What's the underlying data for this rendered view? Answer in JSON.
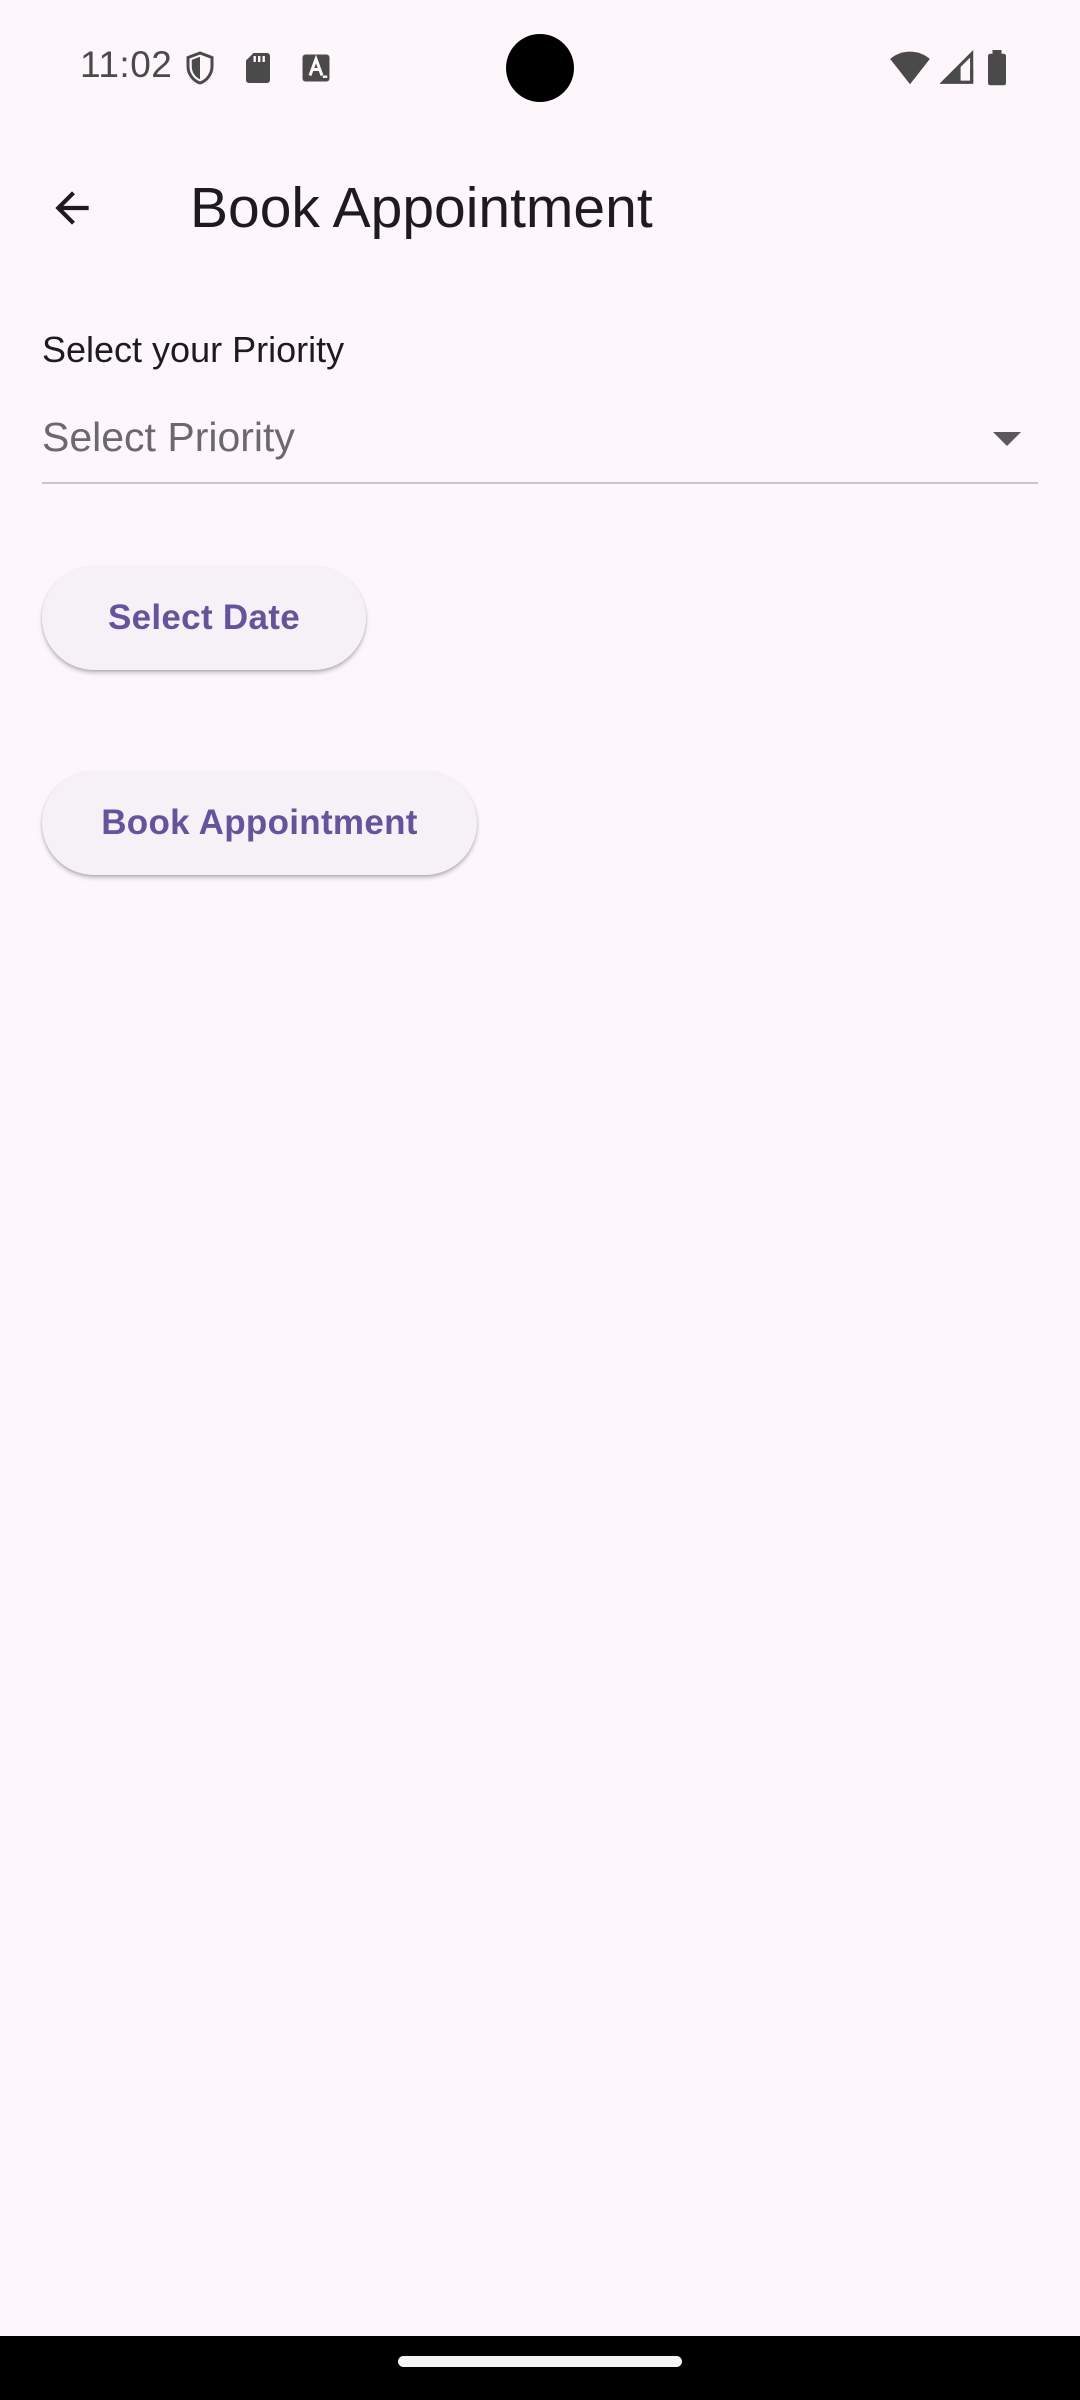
{
  "status_bar": {
    "time": "11:02",
    "left_icons": [
      "shield-icon",
      "sd-card-icon",
      "text-icon"
    ],
    "right_icons": [
      "wifi-icon",
      "signal-icon",
      "battery-icon"
    ]
  },
  "app_bar": {
    "back_icon": "arrow-back-icon",
    "title": "Book Appointment"
  },
  "form": {
    "priority_label": "Select your Priority",
    "priority_placeholder": "Select Priority",
    "select_date_label": "Select Date",
    "book_label": "Book Appointment"
  },
  "colors": {
    "background": "#fdf7fc",
    "button_text": "#65539b",
    "button_background": "#f6f1f6"
  }
}
